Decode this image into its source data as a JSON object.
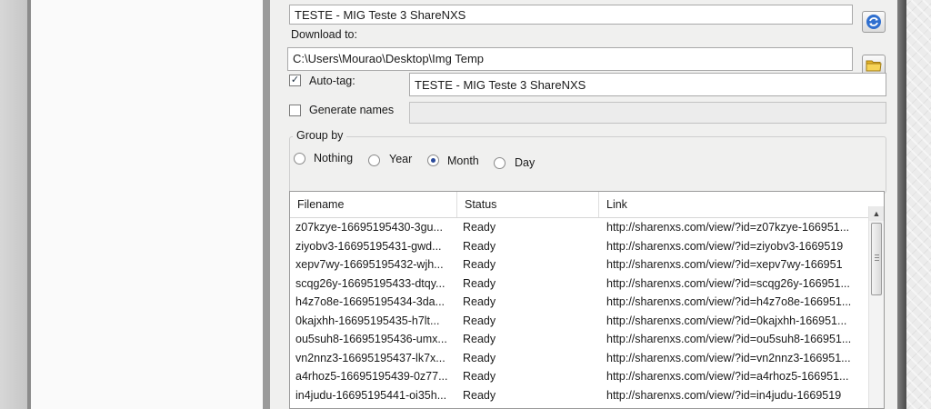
{
  "top_field": {
    "value": "TESTE - MIG  Teste 3  ShareNXS",
    "refresh_icon": "refresh-icon"
  },
  "download": {
    "label": "Download to:",
    "path": "C:\\Users\\Mourao\\Desktop\\Img Temp",
    "browse_icon": "folder-icon"
  },
  "autotag": {
    "label": "Auto-tag:",
    "checked": true,
    "value": "TESTE - MIG  Teste 3  ShareNXS"
  },
  "generate_names": {
    "label": "Generate names",
    "checked": false,
    "value": ""
  },
  "group_by": {
    "label": "Group by",
    "options": [
      "Nothing",
      "Year",
      "Month",
      "Day"
    ],
    "selected": "Month"
  },
  "table": {
    "columns": [
      "Filename",
      "Status",
      "Link"
    ],
    "rows": [
      {
        "filename": "z07kzye-16695195430-3gu...",
        "status": "Ready",
        "link": "http://sharenxs.com/view/?id=z07kzye-166951..."
      },
      {
        "filename": "ziyobv3-16695195431-gwd...",
        "status": "Ready",
        "link": "http://sharenxs.com/view/?id=ziyobv3-1669519"
      },
      {
        "filename": "xepv7wy-16695195432-wjh...",
        "status": "Ready",
        "link": "http://sharenxs.com/view/?id=xepv7wy-166951"
      },
      {
        "filename": "scqg26y-16695195433-dtqy...",
        "status": "Ready",
        "link": "http://sharenxs.com/view/?id=scqg26y-166951..."
      },
      {
        "filename": "h4z7o8e-16695195434-3da...",
        "status": "Ready",
        "link": "http://sharenxs.com/view/?id=h4z7o8e-166951..."
      },
      {
        "filename": "0kajxhh-16695195435-h7lt...",
        "status": "Ready",
        "link": "http://sharenxs.com/view/?id=0kajxhh-166951..."
      },
      {
        "filename": "ou5suh8-16695195436-umx...",
        "status": "Ready",
        "link": "http://sharenxs.com/view/?id=ou5suh8-166951..."
      },
      {
        "filename": "vn2nnz3-16695195437-lk7x...",
        "status": "Ready",
        "link": "http://sharenxs.com/view/?id=vn2nnz3-166951..."
      },
      {
        "filename": "a4rhoz5-16695195439-0z77...",
        "status": "Ready",
        "link": "http://sharenxs.com/view/?id=a4rhoz5-166951..."
      },
      {
        "filename": "in4judu-16695195441-oi35h...",
        "status": "Ready",
        "link": "http://sharenxs.com/view/?id=in4judu-1669519"
      }
    ]
  }
}
